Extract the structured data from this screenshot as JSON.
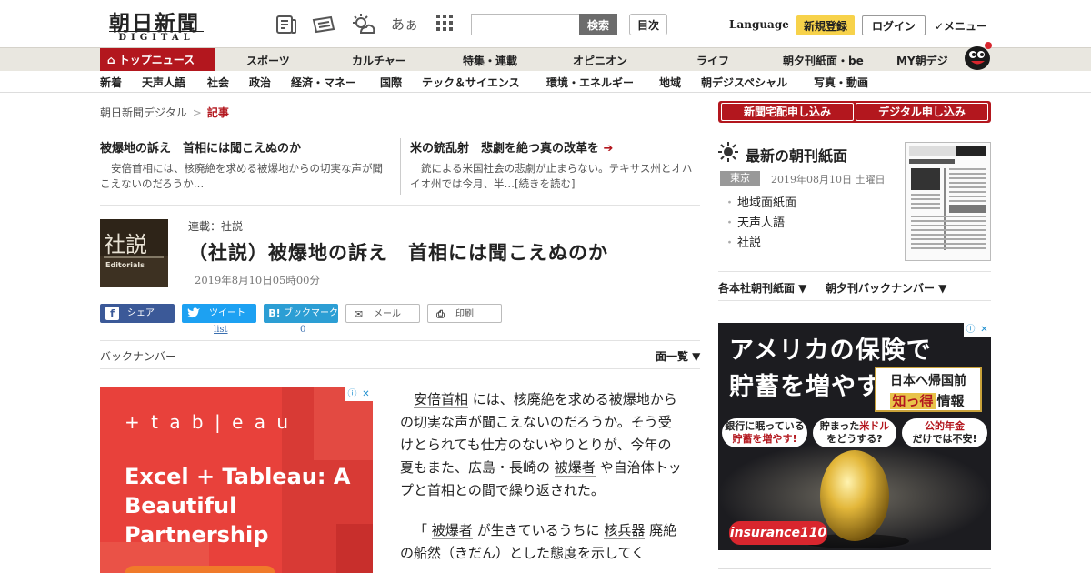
{
  "header": {
    "logo_kanji": "朝日新聞",
    "logo_sub": "DIGITAL",
    "font_toggle_label": "あぁ",
    "search_button": "検索",
    "toc_button": "目次",
    "language": "Language",
    "register": "新規登録",
    "login": "ログイン",
    "menu": "✓メニュー"
  },
  "nav_primary": {
    "home": "トップニュース",
    "items": [
      "スポーツ",
      "カルチャー",
      "特集・連載",
      "オピニオン",
      "ライフ",
      "朝夕刊紙面・be",
      "MY朝デジ"
    ]
  },
  "nav_secondary": {
    "items": [
      "新着",
      "天声人語",
      "社会",
      "政治",
      "経済・マネー",
      "国際",
      "テック＆サイエンス",
      "環境・エネルギー",
      "地域",
      "朝デジスペシャル",
      "写真・動画"
    ]
  },
  "breadcrumb": {
    "root": "朝日新聞デジタル",
    "separator": ">",
    "current": "記事"
  },
  "related": [
    {
      "title": "被爆地の訴え　首相には聞こえぬのか",
      "excerpt": "安倍首相には、核廃絶を求める被爆地からの切実な声が聞こえないのだろうか…"
    },
    {
      "title": "米の銃乱射　悲劇を絶つ真の改革を",
      "arrow": "➔",
      "excerpt": "銃による米国社会の悲劇が止まらない。テキサス州とオハイオ州では今月、半…[続きを読む]"
    }
  ],
  "article": {
    "image_label_kanji": "社説",
    "image_label_en": "Editorials",
    "series": "連載：社説",
    "headline": "（社説）被爆地の訴え　首相には聞こえぬのか",
    "date": "2019年8月10日05時00分",
    "share": {
      "facebook": "シェア",
      "twitter": "ツイート",
      "twitter_count": "list",
      "hatena_icon": "B!",
      "hatena": "ブックマーク",
      "hatena_count": "0",
      "mail": "メール",
      "print": "印刷"
    },
    "back_number": "バックナンバー",
    "list_label": "面一覧 ▼",
    "paragraphs": [
      {
        "t1": "安倍首相",
        "t2": " には、核廃絶を求める被爆地からの切実な声が聞こえないのだろうか。そう受けとられても仕方のないやりとりが、今年の夏もまた、広島・長崎の ",
        "t3": "被爆者",
        "t4": " や自治体トップと首相との間で繰り返された。"
      },
      {
        "t1": "「 ",
        "t2": "被爆者",
        "t3": " が生きているうちに ",
        "t4": "核兵器",
        "t5": " 廃絶の船然（きだん）とした態度を示してく"
      }
    ]
  },
  "ads": {
    "left": {
      "brand": "+ t a b | e a u",
      "headline": "Excel + Tableau: A Beautiful Partnership"
    },
    "right": {
      "line1": "アメリカの保険で",
      "line2": "貯蓄を増やす",
      "box_line1": "日本へ帰国前",
      "box_line2": "知っ得",
      "box_line3": "情報",
      "bubble1_a": "銀行に眠っている",
      "bubble1_b": "貯蓄を増やす!",
      "bubble2_a": "貯まった",
      "bubble2_b": "米ドル",
      "bubble2_c": "をどうする?",
      "bubble3_a": "公的年金",
      "bubble3_b": "だけでは不安!",
      "logo": "insurance110"
    }
  },
  "sidebar": {
    "subscribe_paper": "新聞宅配申し込み",
    "subscribe_digital": "デジタル申し込み",
    "choukan_title": "最新の朝刊紙面",
    "region": "東京",
    "choukan_date": "2019年08月10日 土曜日",
    "choukan_items": [
      "地域面紙面",
      "天声人語",
      "社説"
    ],
    "links": [
      "各本社朝刊紙面 ▼",
      "朝夕刊バックナンバー ▼"
    ]
  },
  "colors": {
    "brand_red": "#b3171e",
    "nav_bg": "#e9e7e0",
    "register_yellow": "#f7d24a",
    "tableau_red": "#e8413b"
  }
}
